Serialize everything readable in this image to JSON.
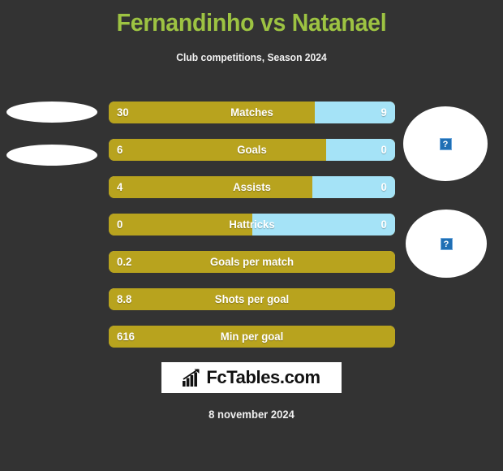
{
  "header": {
    "title": "Fernandinho vs Natanael",
    "subtitle": "Club competitions, Season 2024",
    "title_color": "#9dc342"
  },
  "theme": {
    "background": "#333333",
    "home_color": "#b8a31e",
    "away_color": "#a5e3f7",
    "text_color": "#ffffff"
  },
  "players": {
    "home": {
      "name": "Fernandinho",
      "photo_placeholder": "broken-image-icon"
    },
    "away": {
      "name": "Natanael",
      "photo_placeholder": "broken-image-icon"
    }
  },
  "stats": [
    {
      "label": "Matches",
      "home": "30",
      "away": "9",
      "home_pct": 72,
      "split": true
    },
    {
      "label": "Goals",
      "home": "6",
      "away": "0",
      "home_pct": 76,
      "split": true
    },
    {
      "label": "Assists",
      "home": "4",
      "away": "0",
      "home_pct": 71,
      "split": true
    },
    {
      "label": "Hattricks",
      "home": "0",
      "away": "0",
      "home_pct": 50,
      "split": true
    },
    {
      "label": "Goals per match",
      "home": "0.2",
      "away": "",
      "home_pct": 100,
      "split": false
    },
    {
      "label": "Shots per goal",
      "home": "8.8",
      "away": "",
      "home_pct": 100,
      "split": false
    },
    {
      "label": "Min per goal",
      "home": "616",
      "away": "",
      "home_pct": 100,
      "split": false
    }
  ],
  "logo": {
    "text": "FcTables.com",
    "icon": "bar-chart-growth-icon"
  },
  "footer": {
    "date": "8 november 2024"
  }
}
